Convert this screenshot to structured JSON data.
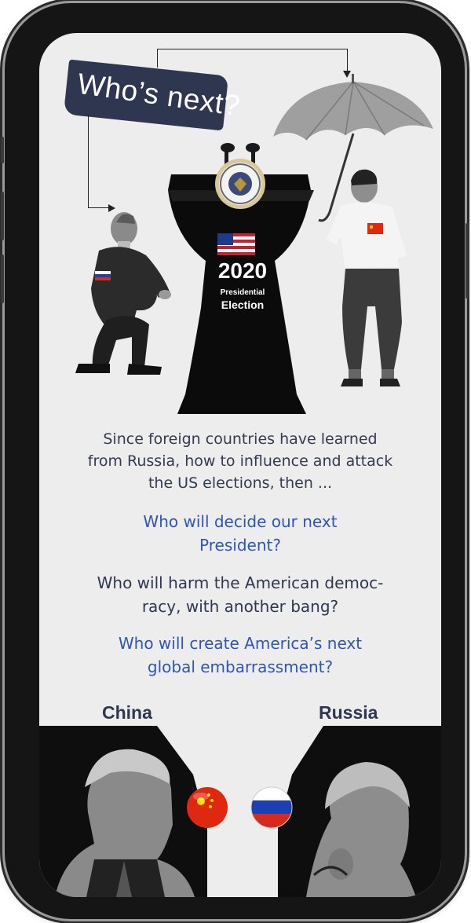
{
  "banner": {
    "text": "Who’s next?"
  },
  "podium": {
    "year": "2020",
    "subtitle_line1": "Presidential",
    "subtitle_line2": "Election"
  },
  "body_text": {
    "intro_lines": [
      "Since foreign countries have learned",
      "from Russia, how to influence and attack",
      "the US elections, then ..."
    ],
    "question1_lines": [
      "Who will decide our next",
      "President?"
    ],
    "question2_lines": [
      "Who will harm the American democ-",
      "racy, with another bang?"
    ],
    "question3_lines": [
      "Who will create America’s next",
      "global embarrassment?"
    ]
  },
  "bottom": {
    "label_left": "China",
    "label_right": "Russia"
  },
  "colors": {
    "navy": "#2f3750",
    "blue_text": "#2f55b8",
    "podium": "#0b0b0b",
    "screen_bg": "#ededed"
  },
  "icons": [
    "russia-flag-icon",
    "china-flag-icon",
    "usa-flag-icon",
    "presidential-seal-icon",
    "china-flag-ball-icon",
    "russia-flag-ball-icon"
  ]
}
